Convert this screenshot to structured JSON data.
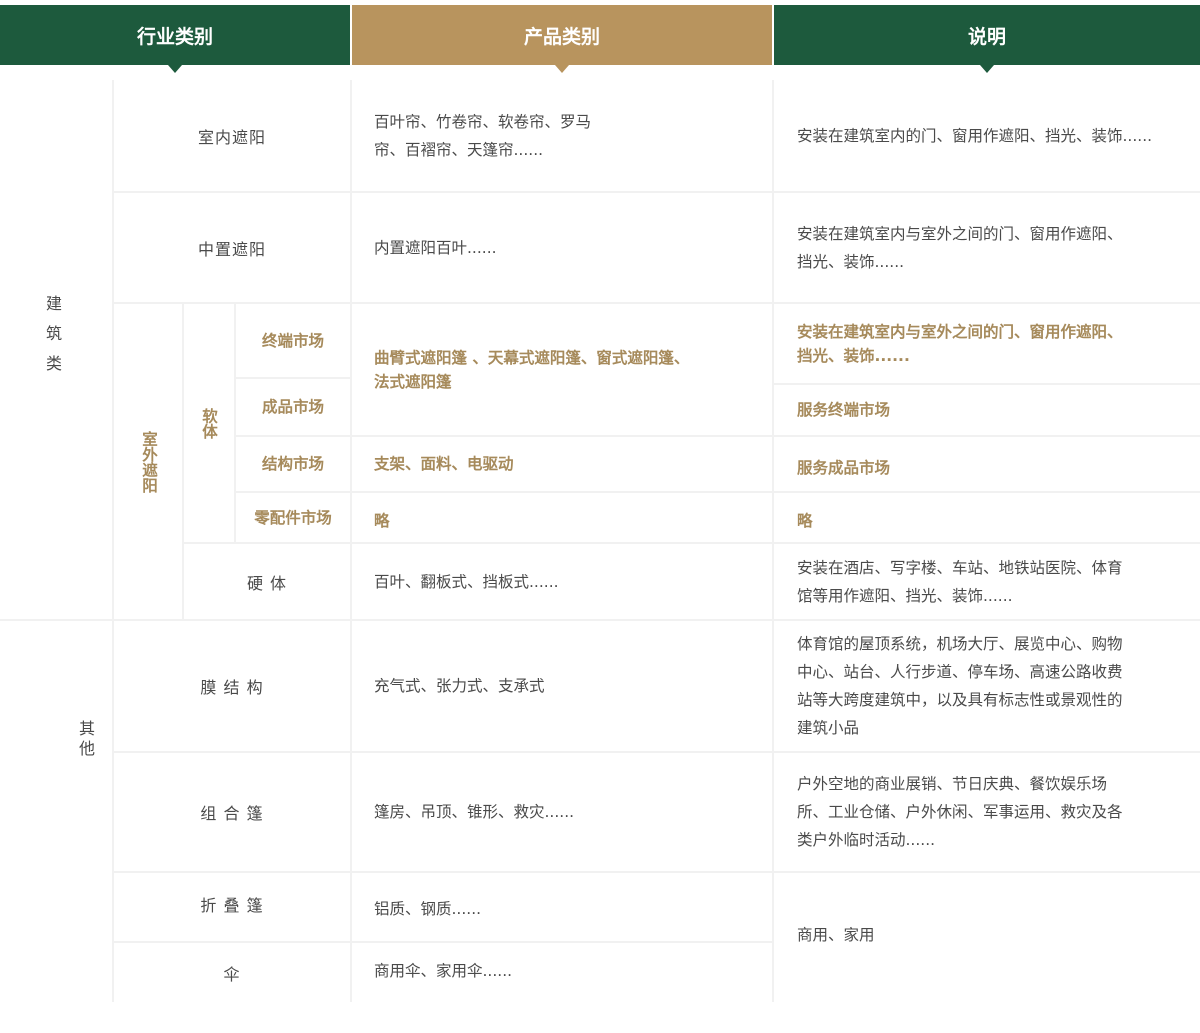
{
  "header": {
    "industry": "行业类别",
    "product": "产品类别",
    "description": "说明"
  },
  "groups": {
    "building": "建筑类",
    "others": "其他",
    "outdoor": "室外遮阳",
    "soft": "软体"
  },
  "rows": {
    "indoor": {
      "label": "室内遮阳",
      "product_line1": "百叶帘、竹卷帘、软卷帘、罗马",
      "product_line2": "帘、百褶帘、天篷帘......",
      "desc": "安装在建筑室内的门、窗用作遮阳、挡光、装饰......"
    },
    "middle": {
      "label": "中置遮阳",
      "product": "内置遮阳百叶......",
      "desc_line1": "安装在建筑室内与室外之间的门、窗用作遮阳、",
      "desc_line2": "挡光、装饰......"
    },
    "terminal": {
      "label": "终端市场",
      "desc_line1": "安装在建筑室内与室外之间的门、窗用作遮阳、",
      "desc_line2": "挡光、装饰......"
    },
    "soft_products": {
      "line1": "曲臂式遮阳篷 、天幕式遮阳篷、窗式遮阳篷、",
      "line2": "法式遮阳篷"
    },
    "finished": {
      "label": "成品市场",
      "desc": "服务终端市场"
    },
    "structure": {
      "label": "结构市场",
      "product": "支架、面料、电驱动",
      "desc": "服务成品市场"
    },
    "parts": {
      "label": "零配件市场",
      "product": "略",
      "desc": "略"
    },
    "hard": {
      "label": "硬 体",
      "product": "百叶、翻板式、挡板式......",
      "desc_line1": "安装在酒店、写字楼、车站、地铁站医院、体育",
      "desc_line2": "馆等用作遮阳、挡光、装饰......"
    },
    "membrane": {
      "label": "膜 结 构",
      "product": "充气式、张力式、支承式",
      "desc_line1": "体育馆的屋顶系统，机场大厅、展览中心、购物",
      "desc_line2": "中心、站台、人行步道、停车场、高速公路收费",
      "desc_line3": "站等大跨度建筑中，以及具有标志性或景观性的",
      "desc_line4": "建筑小品"
    },
    "combo": {
      "label": "组 合 篷",
      "product": "篷房、吊顶、锥形、救灾......",
      "desc_line1": "户外空地的商业展销、节日庆典、餐饮娱乐场",
      "desc_line2": "所、工业仓储、户外休闲、军事运用、救灾及各",
      "desc_line3": "类户外临时活动......"
    },
    "folding": {
      "label": "折 叠 篷",
      "product": "铝质、钢质......"
    },
    "umbrella": {
      "label": "伞",
      "product": "商用伞、家用伞......"
    },
    "folding_umbrella_desc": "商用、家用"
  },
  "colors": {
    "green": "#1d5a3d",
    "gold": "#b8945e",
    "gold_text": "#a68a5b",
    "text": "#4a4a4a",
    "line": "#f1f1f1"
  }
}
